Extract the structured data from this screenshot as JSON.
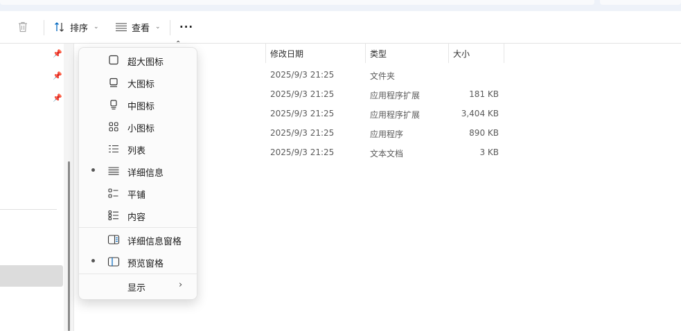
{
  "toolbar": {
    "sort_label": "排序",
    "view_label": "查看",
    "more_label": "···"
  },
  "columns": {
    "date": "修改日期",
    "type": "类型",
    "size": "大小"
  },
  "files": [
    {
      "date": "2025/9/3 21:25",
      "type": "文件夹",
      "size": ""
    },
    {
      "date": "2025/9/3 21:25",
      "type": "应用程序扩展",
      "size": "181 KB"
    },
    {
      "date": "2025/9/3 21:25",
      "type": "应用程序扩展",
      "size": "3,404 KB"
    },
    {
      "date": "2025/9/3 21:25",
      "type": "应用程序",
      "size": "890 KB"
    },
    {
      "date": "2025/9/3 21:25",
      "type": "文本文档",
      "size": "3 KB"
    }
  ],
  "view_menu": {
    "items": [
      {
        "label": "超大图标",
        "icon": "extra-large-icons-icon",
        "selected": false
      },
      {
        "label": "大图标",
        "icon": "large-icons-icon",
        "selected": false
      },
      {
        "label": "中图标",
        "icon": "medium-icons-icon",
        "selected": false
      },
      {
        "label": "小图标",
        "icon": "small-icons-icon",
        "selected": false
      },
      {
        "label": "列表",
        "icon": "list-icon",
        "selected": false
      },
      {
        "label": "详细信息",
        "icon": "details-icon",
        "selected": true
      },
      {
        "label": "平铺",
        "icon": "tiles-icon",
        "selected": false
      },
      {
        "label": "内容",
        "icon": "content-icon",
        "selected": false
      }
    ],
    "pane_items": [
      {
        "label": "详细信息窗格",
        "icon": "details-pane-icon",
        "selected": false
      },
      {
        "label": "预览窗格",
        "icon": "preview-pane-icon",
        "selected": true
      }
    ],
    "show_label": "显示"
  },
  "colors": {
    "accent": "#0067c0",
    "menu_bg": "#fbfbfb",
    "nav_selected": "#dcdcdc"
  }
}
